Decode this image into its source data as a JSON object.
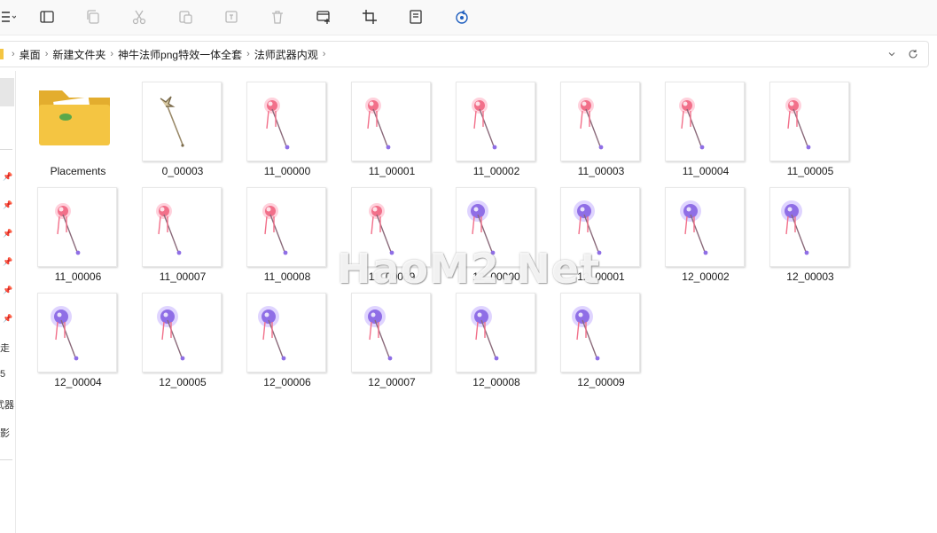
{
  "toolbar": {
    "buttons": [
      {
        "icon": "menu-icon"
      },
      {
        "icon": "details-pane-icon"
      },
      {
        "icon": "copy-icon"
      },
      {
        "icon": "cut-icon"
      },
      {
        "icon": "paste-icon"
      },
      {
        "icon": "rename-icon"
      },
      {
        "icon": "delete-icon"
      },
      {
        "icon": "set-wallpaper-icon"
      },
      {
        "icon": "crop-icon"
      },
      {
        "icon": "print-icon"
      },
      {
        "icon": "rotate-icon"
      }
    ]
  },
  "address": {
    "crumbs": [
      "桌面",
      "新建文件夹",
      "神牛法师png特效一体全套",
      "法师武器内观"
    ]
  },
  "sidebar": {
    "labels": [
      "走",
      "5",
      "武器",
      "影"
    ]
  },
  "files": [
    {
      "name": "Placements",
      "type": "folder"
    },
    {
      "name": "0_00003",
      "type": "image"
    },
    {
      "name": "11_00000",
      "type": "image"
    },
    {
      "name": "11_00001",
      "type": "image"
    },
    {
      "name": "11_00002",
      "type": "image"
    },
    {
      "name": "11_00003",
      "type": "image"
    },
    {
      "name": "11_00004",
      "type": "image"
    },
    {
      "name": "11_00005",
      "type": "image"
    },
    {
      "name": "11_00006",
      "type": "image"
    },
    {
      "name": "11_00007",
      "type": "image"
    },
    {
      "name": "11_00008",
      "type": "image"
    },
    {
      "name": "11_00009",
      "type": "image"
    },
    {
      "name": "12_00000",
      "type": "image"
    },
    {
      "name": "12_00001",
      "type": "image"
    },
    {
      "name": "12_00002",
      "type": "image"
    },
    {
      "name": "12_00003",
      "type": "image"
    },
    {
      "name": "12_00004",
      "type": "image"
    },
    {
      "name": "12_00005",
      "type": "image"
    },
    {
      "name": "12_00006",
      "type": "image"
    },
    {
      "name": "12_00007",
      "type": "image"
    },
    {
      "name": "12_00008",
      "type": "image"
    },
    {
      "name": "12_00009",
      "type": "image"
    }
  ],
  "watermark": "HaoM2.Net",
  "colors": {
    "folder": "#f4c542",
    "staff_pink": "#f2708a",
    "staff_violet": "#8f6ee6"
  }
}
